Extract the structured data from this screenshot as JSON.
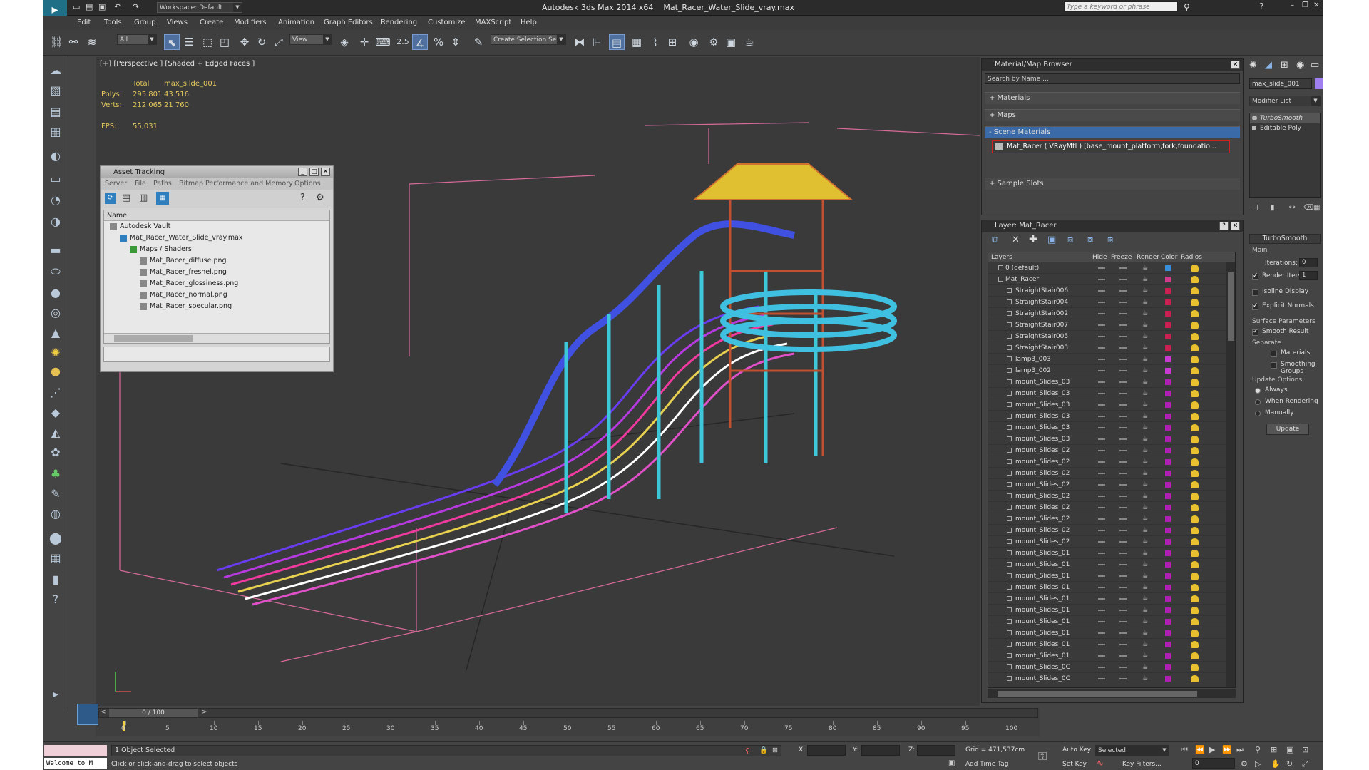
{
  "app": {
    "title": "Autodesk 3ds Max  2014 x64",
    "file": "Mat_Racer_Water_Slide_vray.max",
    "workspace": "Workspace: Default",
    "search_placeholder": "Type a keyword or phrase"
  },
  "menu": [
    "Edit",
    "Tools",
    "Group",
    "Views",
    "Create",
    "Modifiers",
    "Animation",
    "Graph Editors",
    "Rendering",
    "Customize",
    "MAXScript",
    "Help"
  ],
  "toolbar": {
    "filter": "All",
    "refcoord": "View",
    "snap": "2.5",
    "selset": "Create Selection Se"
  },
  "viewport": {
    "label": "[+] [Perspective ] [Shaded + Edged Faces ]",
    "stats": {
      "total": "Total",
      "object": "max_slide_001",
      "polys_label": "Polys:",
      "polys_total": "295 801",
      "polys_obj": "43 516",
      "verts_label": "Verts:",
      "verts_total": "212 065",
      "verts_obj": "21 760",
      "fps_label": "FPS:",
      "fps": "55,031"
    }
  },
  "asset_tracking": {
    "title": "Asset Tracking",
    "menu": [
      "Server",
      "File",
      "Paths",
      "Bitmap Performance and Memory",
      "Options"
    ],
    "col": "Name",
    "items": [
      {
        "label": "Autodesk Vault",
        "indent": 0
      },
      {
        "label": "Mat_Racer_Water_Slide_vray.max",
        "indent": 1
      },
      {
        "label": "Maps / Shaders",
        "indent": 2
      },
      {
        "label": "Mat_Racer_diffuse.png",
        "indent": 3
      },
      {
        "label": "Mat_Racer_fresnel.png",
        "indent": 3
      },
      {
        "label": "Mat_Racer_glossiness.png",
        "indent": 3
      },
      {
        "label": "Mat_Racer_normal.png",
        "indent": 3
      },
      {
        "label": "Mat_Racer_specular.png",
        "indent": 3
      }
    ]
  },
  "material_browser": {
    "title": "Material/Map Browser",
    "search": "Search by Name ...",
    "sections": [
      "+ Materials",
      "+ Maps",
      "- Scene Materials",
      "+ Sample Slots"
    ],
    "scene_material": "Mat_Racer ( VRayMtl ) [base_mount_platform,fork,foundatio..."
  },
  "layer_window": {
    "title": "Layer: Mat_Racer",
    "cols": [
      "Layers",
      "Hide",
      "Freeze",
      "Render",
      "Color",
      "Radios"
    ],
    "rows": [
      {
        "name": "0 (default)",
        "lvl": 0,
        "color": "#3a8fd8"
      },
      {
        "name": "Mat_Racer",
        "lvl": 0,
        "color": "#d23a8a"
      },
      {
        "name": "StraightStair006",
        "lvl": 1,
        "color": "#c82050"
      },
      {
        "name": "StraightStair004",
        "lvl": 1,
        "color": "#c82050"
      },
      {
        "name": "StraightStair002",
        "lvl": 1,
        "color": "#c82050"
      },
      {
        "name": "StraightStair007",
        "lvl": 1,
        "color": "#c82050"
      },
      {
        "name": "StraightStair005",
        "lvl": 1,
        "color": "#c82050"
      },
      {
        "name": "StraightStair003",
        "lvl": 1,
        "color": "#c82050"
      },
      {
        "name": "lamp3_003",
        "lvl": 1,
        "color": "#c83ad0"
      },
      {
        "name": "lamp3_002",
        "lvl": 1,
        "color": "#c83ad0"
      },
      {
        "name": "mount_Slides_03",
        "lvl": 1,
        "color": "#b020b0"
      },
      {
        "name": "mount_Slides_03",
        "lvl": 1,
        "color": "#b020b0"
      },
      {
        "name": "mount_Slides_03",
        "lvl": 1,
        "color": "#b020b0"
      },
      {
        "name": "mount_Slides_03",
        "lvl": 1,
        "color": "#b020b0"
      },
      {
        "name": "mount_Slides_03",
        "lvl": 1,
        "color": "#b020b0"
      },
      {
        "name": "mount_Slides_03",
        "lvl": 1,
        "color": "#b020b0"
      },
      {
        "name": "mount_Slides_02",
        "lvl": 1,
        "color": "#b020b0"
      },
      {
        "name": "mount_Slides_02",
        "lvl": 1,
        "color": "#b020b0"
      },
      {
        "name": "mount_Slides_02",
        "lvl": 1,
        "color": "#b020b0"
      },
      {
        "name": "mount_Slides_02",
        "lvl": 1,
        "color": "#b020b0"
      },
      {
        "name": "mount_Slides_02",
        "lvl": 1,
        "color": "#b020b0"
      },
      {
        "name": "mount_Slides_02",
        "lvl": 1,
        "color": "#b020b0"
      },
      {
        "name": "mount_Slides_02",
        "lvl": 1,
        "color": "#b020b0"
      },
      {
        "name": "mount_Slides_02",
        "lvl": 1,
        "color": "#b020b0"
      },
      {
        "name": "mount_Slides_02",
        "lvl": 1,
        "color": "#b020b0"
      },
      {
        "name": "mount_Slides_01",
        "lvl": 1,
        "color": "#b020b0"
      },
      {
        "name": "mount_Slides_01",
        "lvl": 1,
        "color": "#b020b0"
      },
      {
        "name": "mount_Slides_01",
        "lvl": 1,
        "color": "#b020b0"
      },
      {
        "name": "mount_Slides_01",
        "lvl": 1,
        "color": "#b020b0"
      },
      {
        "name": "mount_Slides_01",
        "lvl": 1,
        "color": "#b020b0"
      },
      {
        "name": "mount_Slides_01",
        "lvl": 1,
        "color": "#b020b0"
      },
      {
        "name": "mount_Slides_01",
        "lvl": 1,
        "color": "#b020b0"
      },
      {
        "name": "mount_Slides_01",
        "lvl": 1,
        "color": "#b020b0"
      },
      {
        "name": "mount_Slides_01",
        "lvl": 1,
        "color": "#b020b0"
      },
      {
        "name": "mount_Slides_01",
        "lvl": 1,
        "color": "#b020b0"
      },
      {
        "name": "mount_Slides_0C",
        "lvl": 1,
        "color": "#b020b0"
      },
      {
        "name": "mount_Slides_0C",
        "lvl": 1,
        "color": "#b020b0"
      }
    ]
  },
  "command_panel": {
    "object_name": "max_slide_001",
    "modifier_list": "Modifier List",
    "stack": [
      "TurboSmooth",
      "Editable Poly"
    ],
    "rollout": "TurboSmooth",
    "main": "Main",
    "iterations_label": "Iterations:",
    "iterations": "0",
    "render_iters_label": "Render Iters:",
    "render_iters": "1",
    "isoline": "Isoline Display",
    "explicit": "Explicit Normals",
    "surface": "Surface Parameters",
    "smooth_result": "Smooth Result",
    "separate": "Separate",
    "materials": "Materials",
    "smoothing_groups": "Smoothing Groups",
    "update_options": "Update Options",
    "always": "Always",
    "when_rendering": "When Rendering",
    "manually": "Manually",
    "update_btn": "Update"
  },
  "timeline": {
    "frame": "0 / 100",
    "ticks": [
      "0",
      "5",
      "10",
      "15",
      "20",
      "25",
      "30",
      "35",
      "40",
      "45",
      "50",
      "55",
      "60",
      "65",
      "70",
      "75",
      "80",
      "85",
      "90",
      "95",
      "100"
    ]
  },
  "status": {
    "welcome": "Welcome to M",
    "selected": "1 Object Selected",
    "prompt": "Click or click-and-drag to select objects",
    "x_label": "X:",
    "y_label": "Y:",
    "z_label": "Z:",
    "grid": "Grid = 471,537cm",
    "auto_key": "Auto Key",
    "set_key": "Set Key",
    "key_mode": "Selected",
    "key_filters": "Key Filters...",
    "add_time_tag": "Add Time Tag",
    "frame_field": "0"
  }
}
